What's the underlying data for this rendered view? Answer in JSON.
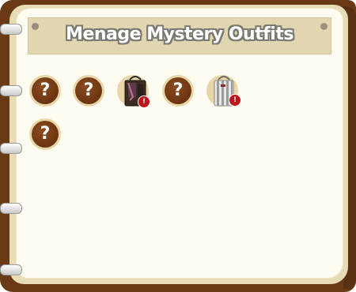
{
  "panel": {
    "title": "Menage Mystery Outfits"
  },
  "slots": [
    {
      "kind": "unknown",
      "glyph": "?"
    },
    {
      "kind": "unknown",
      "glyph": "?"
    },
    {
      "kind": "outfit",
      "icon": "dark-outfit-icon",
      "badge": "!"
    },
    {
      "kind": "unknown",
      "glyph": "?"
    },
    {
      "kind": "outfit",
      "icon": "striped-outfit-icon",
      "badge": "!"
    },
    {
      "kind": "unknown",
      "glyph": "?"
    }
  ],
  "colors": {
    "cover": "#6a3a17",
    "page": "#fefcf0",
    "banner": "#e2d6b1",
    "slot_disc": "#6b3410",
    "badge": "#c0141b"
  }
}
